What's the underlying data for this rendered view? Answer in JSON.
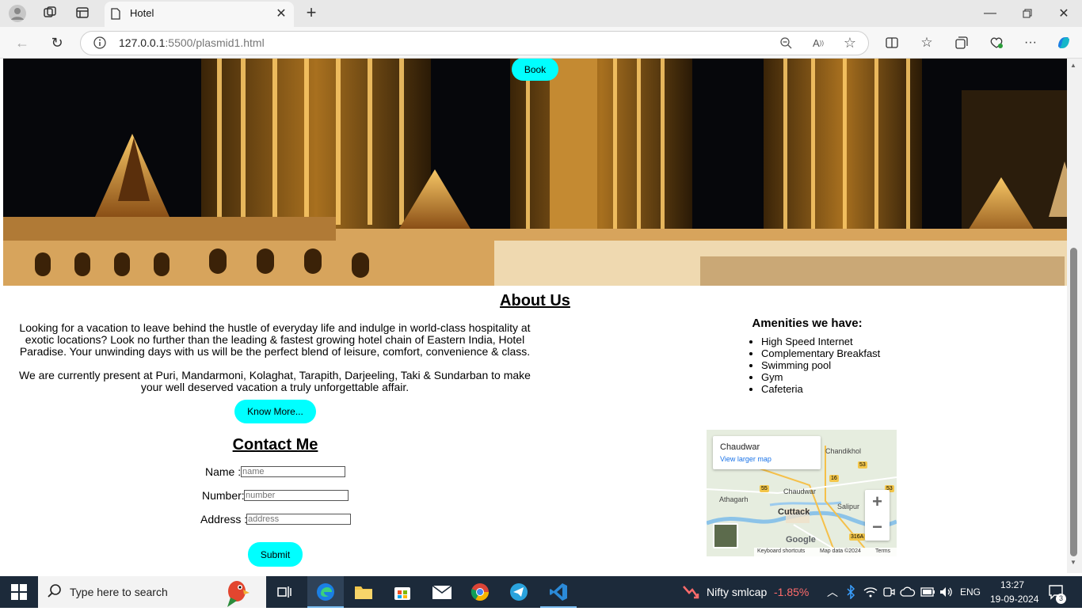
{
  "browser": {
    "tab_title": "Hotel",
    "url_host": "127.0.0.1",
    "url_rest": ":5500/plasmid1.html"
  },
  "page": {
    "book_label": "Book",
    "about_title": "About Us",
    "about_p1": "Looking for a vacation to leave behind the hustle of everyday life and indulge in world-class hospitality at exotic locations? Look no further than the leading & fastest growing hotel chain of Eastern India, Hotel Paradise. Your unwinding days with us will be the perfect blend of leisure, comfort, convenience & class.",
    "about_p2": "We are currently present at Puri, Mandarmoni, Kolaghat, Tarapith, Darjeeling, Taki & Sundarban to make your well deserved vacation a truly unforgettable affair.",
    "know_more_label": "Know More...",
    "contact_title": "Contact Me",
    "form": {
      "name_label": "Name :",
      "name_placeholder": "name",
      "number_label": "Number:",
      "number_placeholder": "number",
      "address_label": "Address :",
      "address_placeholder": "address",
      "submit_label": "Submit"
    },
    "amenities_title": "Amenities we have:",
    "amenities": [
      "High Speed Internet",
      "Complementary Breakfast",
      "Swimming pool",
      "Gym",
      "Cafeteria"
    ],
    "map": {
      "place": "Chaudwar",
      "larger_map": "View larger map",
      "labels": [
        "Chandikhol",
        "Athagarh",
        "Chaudwar",
        "Cuttack",
        "Salipur"
      ],
      "road_badges": [
        "53",
        "16",
        "55",
        "53",
        "316A"
      ],
      "zoom_in": "+",
      "zoom_out": "−",
      "keyboard_shortcuts": "Keyboard shortcuts",
      "map_data": "Map data ©2024",
      "terms": "Terms",
      "logo": "Google"
    }
  },
  "taskbar": {
    "search_placeholder": "Type here to search",
    "stock_name": "Nifty smlcap",
    "stock_change": "-1.85%",
    "language": "ENG",
    "time": "13:27",
    "date": "19-09-2024",
    "notification_count": "3"
  },
  "colors": {
    "accent_button": "#00ffff",
    "stock_negative": "#ff6b6b",
    "taskbar": "#1c2a3a"
  }
}
